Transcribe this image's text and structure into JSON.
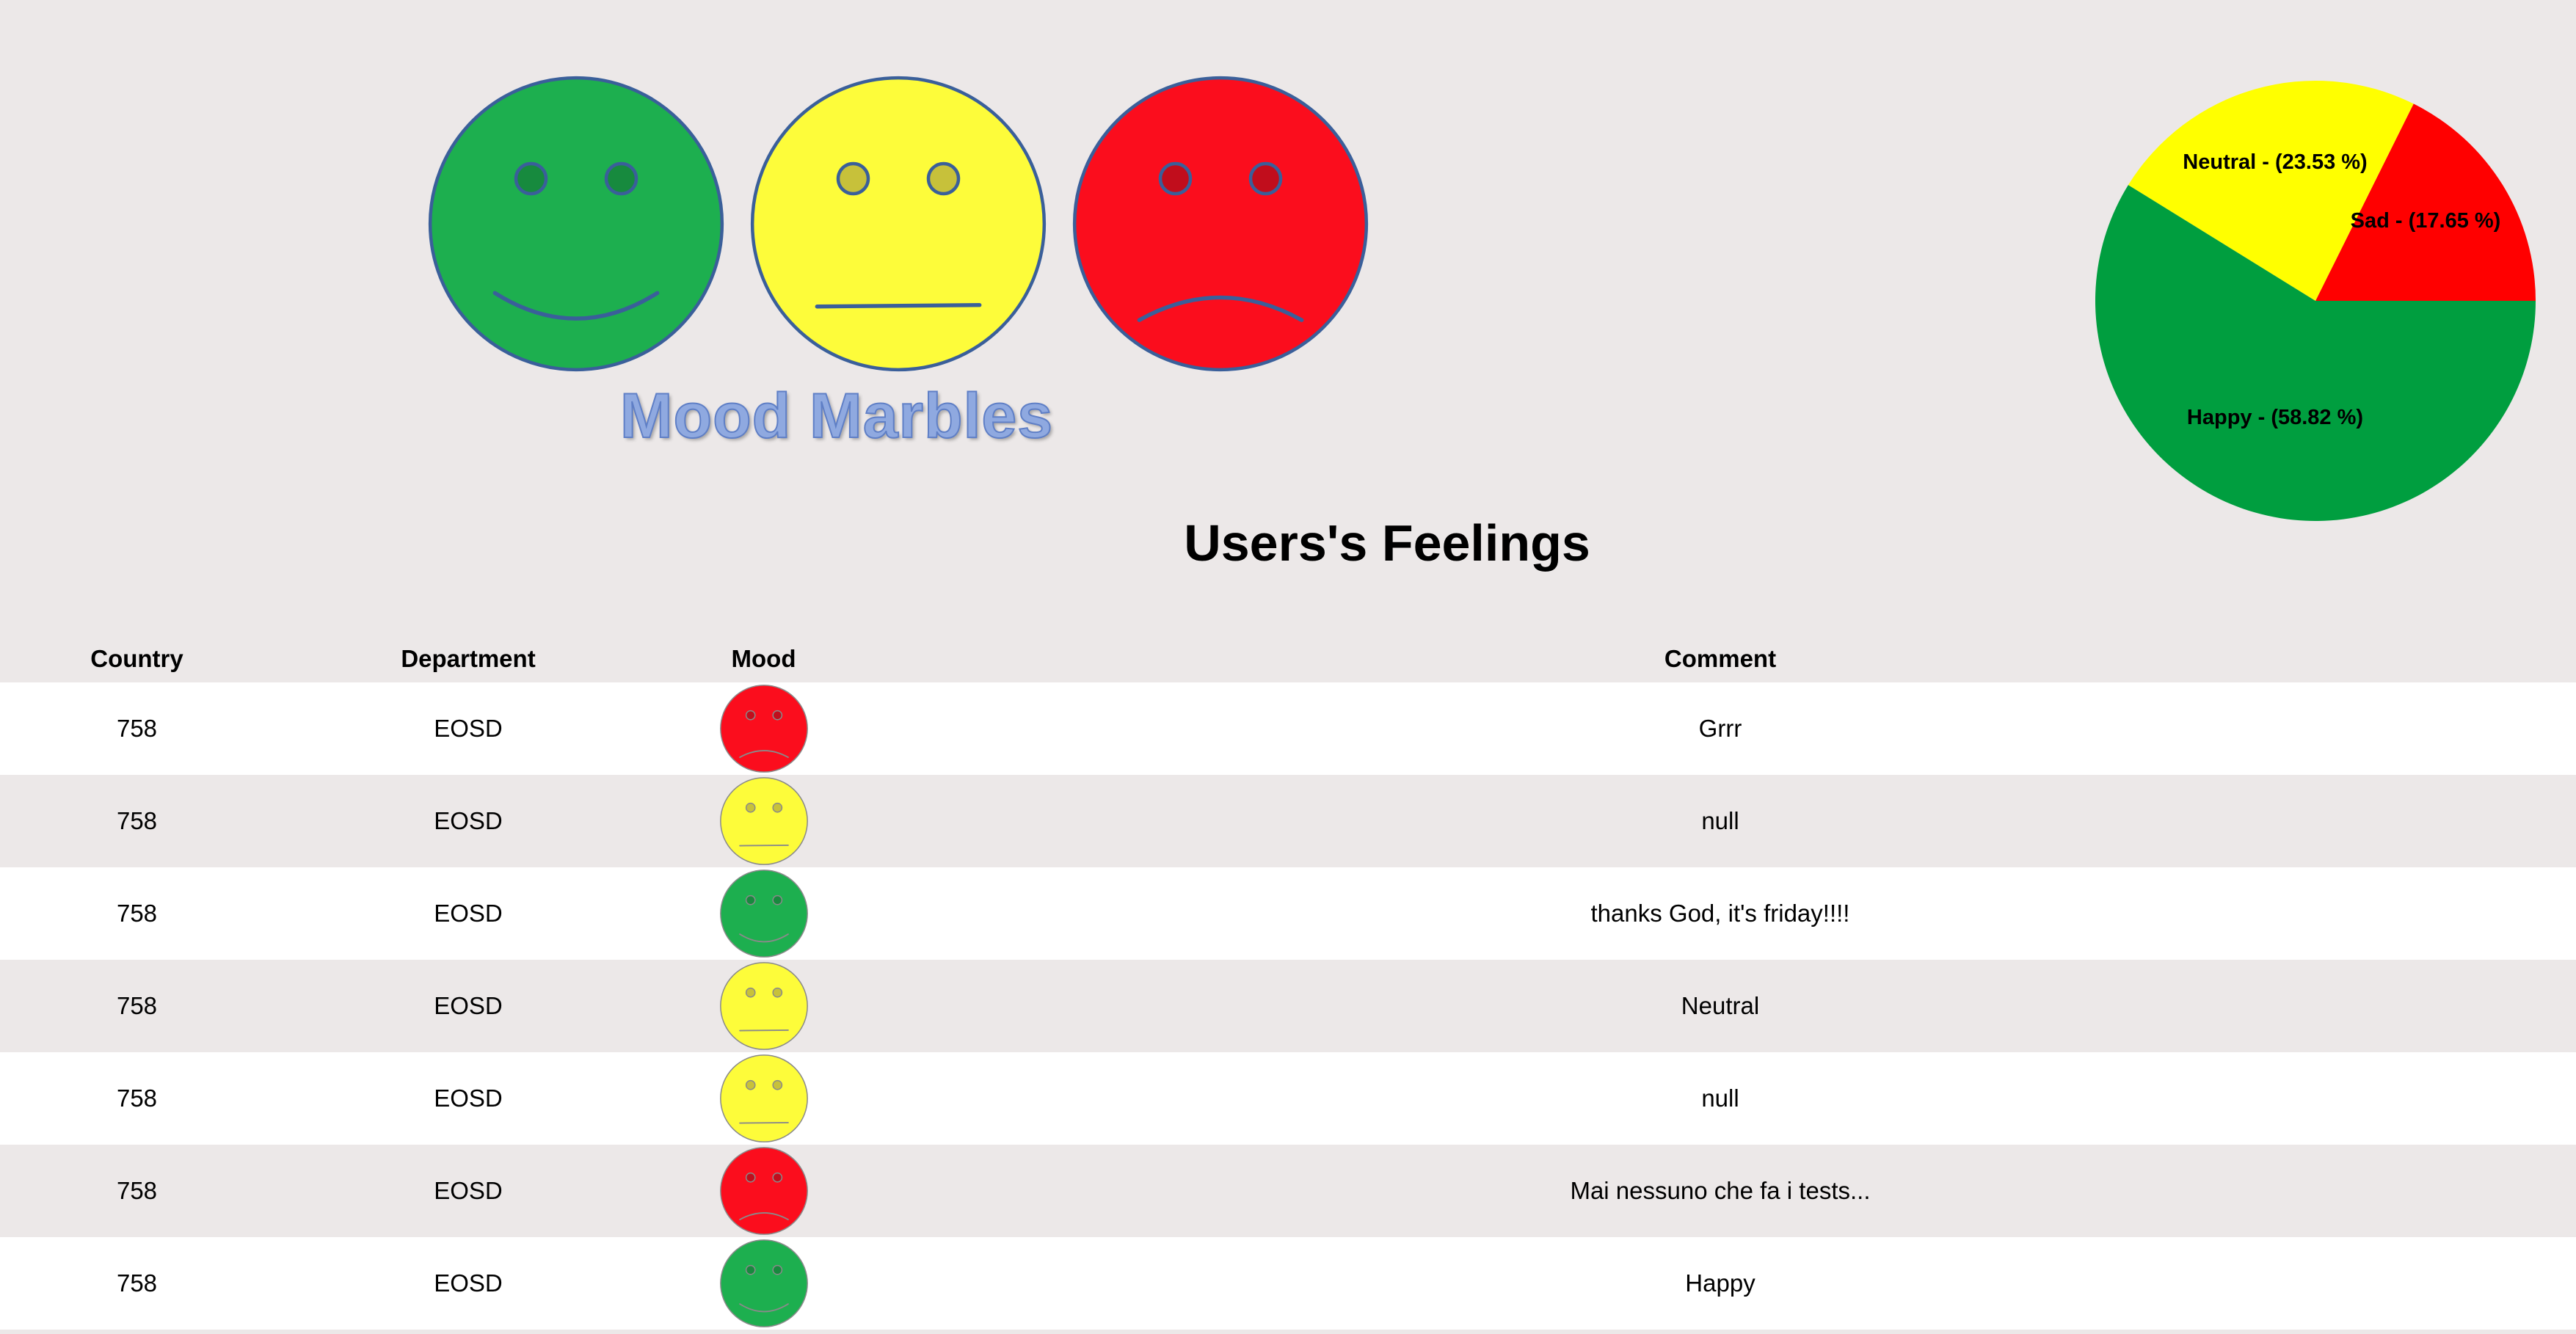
{
  "logo": {
    "title": "Mood Marbles",
    "faces": [
      "happy-face",
      "neutral-face",
      "sad-face"
    ]
  },
  "colors": {
    "happy": "#1daf4f",
    "neutral": "#fdfc3a",
    "sad": "#fb0d1d",
    "pie_happy": "#009e3f",
    "pie_neutral": "#ffff00",
    "pie_sad": "#ff0000",
    "outline": "#3a5f9a",
    "background": "#ece8e8"
  },
  "chart_data": {
    "type": "pie",
    "title": "",
    "slices": [
      {
        "label": "Happy - (58.82 %)",
        "value": 58.82,
        "color": "#009e3f"
      },
      {
        "label": "Neutral - (23.53 %)",
        "value": 23.53,
        "color": "#ffff00"
      },
      {
        "label": "Sad - (17.65 %)",
        "value": 17.65,
        "color": "#ff0000"
      }
    ]
  },
  "page": {
    "title": "Users's Feelings"
  },
  "table": {
    "headers": {
      "country": "Country",
      "department": "Department",
      "mood": "Mood",
      "comment": "Comment"
    },
    "rows": [
      {
        "country": "758",
        "department": "EOSD",
        "mood": "sad",
        "comment": "Grrr"
      },
      {
        "country": "758",
        "department": "EOSD",
        "mood": "neutral",
        "comment": "null"
      },
      {
        "country": "758",
        "department": "EOSD",
        "mood": "happy",
        "comment": "thanks God, it's friday!!!!"
      },
      {
        "country": "758",
        "department": "EOSD",
        "mood": "neutral",
        "comment": "Neutral"
      },
      {
        "country": "758",
        "department": "EOSD",
        "mood": "neutral",
        "comment": "null"
      },
      {
        "country": "758",
        "department": "EOSD",
        "mood": "sad",
        "comment": "Mai nessuno che fa i tests..."
      },
      {
        "country": "758",
        "department": "EOSD",
        "mood": "happy",
        "comment": "Happy"
      }
    ]
  }
}
